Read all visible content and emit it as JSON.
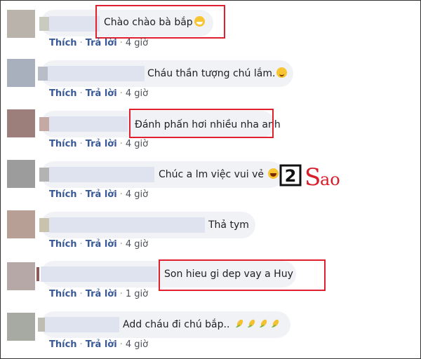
{
  "comments": [
    {
      "text": "Chào chào bà bắp",
      "emoji": "grin-emoji",
      "actions": {
        "like": "Thích",
        "reply": "Trả lời",
        "time": "4 giờ"
      }
    },
    {
      "text": "Cháu thần tượng chú lắm.",
      "emoji": "smile-emoji",
      "actions": {
        "like": "Thích",
        "reply": "Trả lời",
        "time": "4 giờ"
      }
    },
    {
      "text": "Đánh phấn hơi nhiều nha anh",
      "emoji": "",
      "actions": {
        "like": "Thích",
        "reply": "Trả lời",
        "time": "4 giờ"
      }
    },
    {
      "text": "Chúc a lm việc vui vẻ",
      "emoji": "laugh-emoji",
      "actions": {
        "like": "Thích",
        "reply": "Trả lời",
        "time": "4 giờ"
      }
    },
    {
      "text": "Thả tym",
      "emoji": "",
      "actions": {
        "like": "Thích",
        "reply": "Trả lời",
        "time": "4 giờ"
      }
    },
    {
      "text": "Son hieu gi dep vay a Huy",
      "emoji": "",
      "actions": {
        "like": "Thích",
        "reply": "Trả lời",
        "time": "1 giờ"
      }
    },
    {
      "text": "Add cháu đi chú bắp..",
      "emoji": "corn-emoji x4",
      "actions": {
        "like": "Thích",
        "reply": "Trả lời",
        "time": "4 giờ"
      }
    }
  ],
  "watermark": {
    "text": "2Sao"
  },
  "colors": {
    "highlight": "#e0202e",
    "link": "#385898",
    "bubble": "#f0f2f5",
    "logo_red": "#d81d2a"
  }
}
